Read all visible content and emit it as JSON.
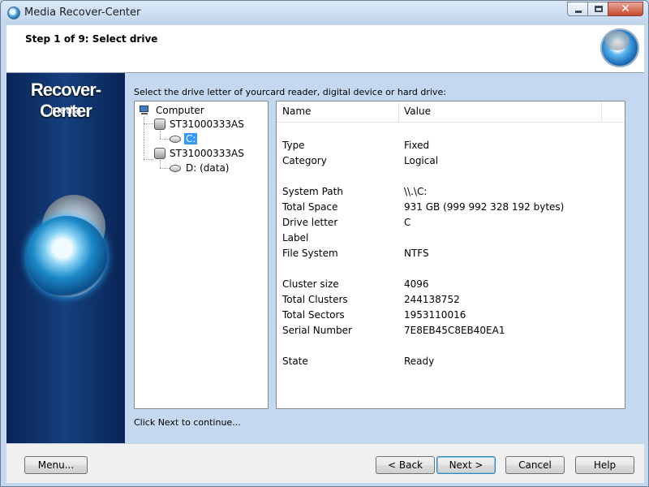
{
  "window": {
    "title": "Media Recover-Center",
    "controls": {
      "close_glyph": "✕"
    }
  },
  "header": {
    "step": "Step 1 of 9: Select drive"
  },
  "banner": {
    "brand": "Recover-Center",
    "subtitle": "media"
  },
  "instruction": "Select the drive letter of yourcard reader, digital device or hard drive:",
  "tree": {
    "root": "Computer",
    "disks": [
      {
        "label": "ST31000333AS",
        "volumes": [
          {
            "label": "C:",
            "selected": true
          }
        ]
      },
      {
        "label": "ST31000333AS",
        "volumes": [
          {
            "label": "D: (data)",
            "selected": false
          }
        ]
      }
    ]
  },
  "properties": {
    "columns": [
      "Name",
      "Value"
    ],
    "rows": [
      {
        "name": "Type",
        "value": "Fixed"
      },
      {
        "name": "Category",
        "value": "Logical"
      },
      {
        "name": "System Path",
        "value": "\\\\.\\C:"
      },
      {
        "name": "Total Space",
        "value": "931 GB (999 992 328 192 bytes)"
      },
      {
        "name": "Drive letter",
        "value": "C"
      },
      {
        "name": "Label",
        "value": ""
      },
      {
        "name": "File System",
        "value": "NTFS"
      },
      {
        "name": "Cluster size",
        "value": "4096"
      },
      {
        "name": "Total Clusters",
        "value": "244138752"
      },
      {
        "name": "Total Sectors",
        "value": "1953110016"
      },
      {
        "name": "Serial Number",
        "value": "7E8EB45C8EB40EA1"
      },
      {
        "name": "State",
        "value": "Ready"
      }
    ]
  },
  "status": "Click Next to continue...",
  "buttons": {
    "menu": "Menu...",
    "back": "< Back",
    "next": "Next >",
    "cancel": "Cancel",
    "help": "Help"
  }
}
